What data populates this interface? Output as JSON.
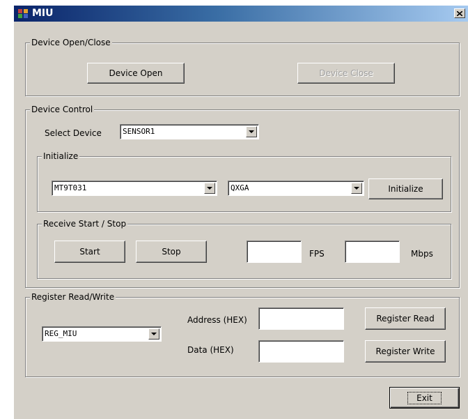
{
  "window": {
    "title": "MIU"
  },
  "open_close": {
    "legend": "Device Open/Close",
    "open_label": "Device Open",
    "close_label": "Device Close"
  },
  "control": {
    "legend": "Device Control",
    "select_label": "Select Device",
    "device_value": "SENSOR1",
    "initialize": {
      "legend": "Initialize",
      "sensor_value": "MT9T031",
      "resolution_value": "QXGA",
      "button_label": "Initialize"
    },
    "receive": {
      "legend": "Receive Start / Stop",
      "start_label": "Start",
      "stop_label": "Stop",
      "fps_label": "FPS",
      "mbps_label": "Mbps"
    }
  },
  "register": {
    "legend": "Register Read/Write",
    "target_value": "REG_MIU",
    "address_label": "Address (HEX)",
    "data_label": "Data (HEX)",
    "read_label": "Register Read",
    "write_label": "Register Write"
  },
  "exit_label": "Exit"
}
